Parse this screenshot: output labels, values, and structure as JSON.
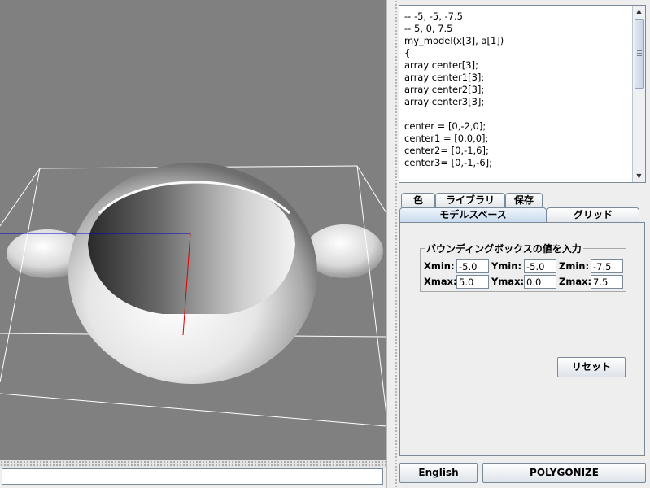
{
  "viewport": {
    "description_icon": "3d-model-view"
  },
  "status_input": {
    "value": ""
  },
  "code_editor": {
    "lines": [
      "-- -5, -5, -7.5",
      "-- 5, 0, 7.5",
      "my_model(x[3], a[1])",
      "{",
      "array center[3];",
      "array center1[3];",
      "array center2[3];",
      "array center3[3];",
      "",
      "center = [0,-2,0];",
      "center1 = [0,0,0];",
      "center2= [0,-1,6];",
      "center3= [0,-1,-6];"
    ]
  },
  "tabs_row1": [
    {
      "label": "色"
    },
    {
      "label": "ライブラリ"
    },
    {
      "label": "保存"
    }
  ],
  "tabs_row2": [
    {
      "label": "モデルスペース",
      "selected": true
    },
    {
      "label": "グリッド",
      "selected": false
    }
  ],
  "bounding_box": {
    "legend": "バウンディングボックスの値を入力",
    "xmin_label": "Xmin:",
    "xmin": "-5.0",
    "ymin_label": "Ymin:",
    "ymin": "-5.0",
    "zmin_label": "Zmin:",
    "zmin": "-7.5",
    "xmax_label": "Xmax:",
    "xmax": "5.0",
    "ymax_label": "Ymax:",
    "ymax": "0.0",
    "zmax_label": "Zmax:",
    "zmax": "7.5"
  },
  "reset_button": "リセット",
  "english_button": "English",
  "polygonize_button": "POLYGONIZE",
  "colors": {
    "viewport_bg": "#808080",
    "axis_x": "#0000cc",
    "axis_y": "#dd0000",
    "box_lines": "#ffffff"
  }
}
